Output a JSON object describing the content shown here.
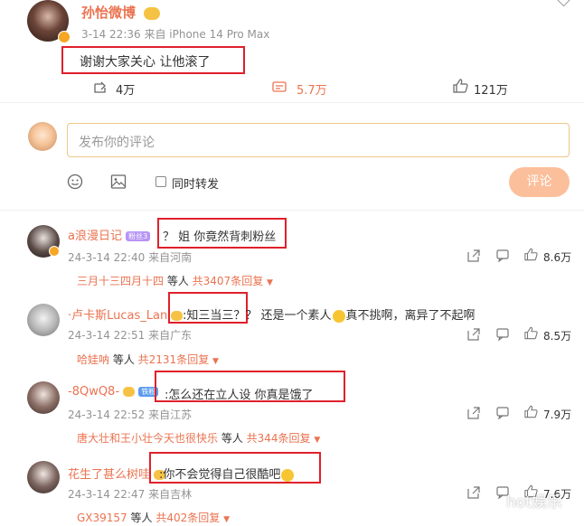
{
  "post": {
    "username": "孙怡微博",
    "timestamp": "3-14 22:36",
    "source": "来自 iPhone 14 Pro Max",
    "content": "谢谢大家关心 让他滚了",
    "reposts": "4万",
    "comments": "5.7万",
    "likes": "121万"
  },
  "composer": {
    "placeholder": "发布你的评论",
    "repost_label": "同时转发",
    "submit_label": "评论"
  },
  "comments": [
    {
      "username": "a浪漫日记",
      "badge": "粉丝3",
      "text": "？ 姐 你竟然背刺粉丝",
      "timestamp": "24-3-14 22:40",
      "location": "来自河南",
      "likes": "8.6万",
      "reply_users": "三月十三四月十四",
      "reply_mid": " 等人 ",
      "reply_count": "共3407条回复"
    },
    {
      "username": "·卢卡斯Lucas_Lan·",
      "text_prefix": ":知三当三？",
      "text_suffix": "？ 还是一个素人",
      "text_tail": "真不挑啊，离异了不起啊",
      "timestamp": "24-3-14 22:51",
      "location": "来自广东",
      "likes": "8.5万",
      "reply_users": "哈娃呐",
      "reply_mid": " 等人 ",
      "reply_count": "共2131条回复"
    },
    {
      "username": "-8QwQ8-",
      "badge": "铁粉",
      "text": ":怎么还在立人设 你真是饿了",
      "timestamp": "24-3-14 22:52",
      "location": "来自江苏",
      "likes": "7.9万",
      "reply_users": "唐大壮和王小壮今天也很快乐",
      "reply_mid": " 等人 ",
      "reply_count": "共344条回复"
    },
    {
      "username": "花生了甚么树哇",
      "text": ":你不会觉得自己很酷吧",
      "timestamp": "24-3-14 22:47",
      "location": "来自吉林",
      "likes": "7.6万",
      "reply_users": "GX39157",
      "reply_mid": " 等人 ",
      "reply_count": "共402条回复"
    }
  ],
  "watermark": "hot娱乐",
  "colors": {
    "accent": "#eb7350",
    "highlight_box": "#e0202b",
    "submit_bg": "#fbbf9b",
    "input_border": "#f0c48a"
  }
}
